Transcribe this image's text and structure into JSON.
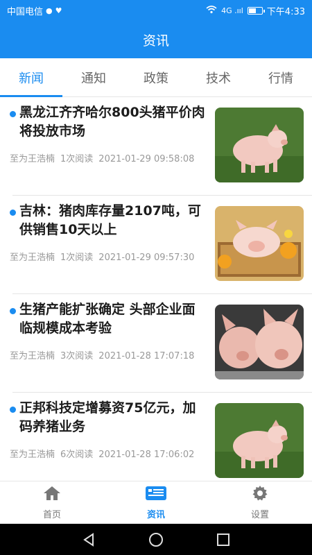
{
  "status_bar": {
    "carrier": "中国电信",
    "signal": "4G .ııl",
    "time": "下午4:33",
    "battery_level": 0.6
  },
  "header": {
    "title": "资讯"
  },
  "tabs": [
    {
      "label": "新闻",
      "active": true
    },
    {
      "label": "通知",
      "active": false
    },
    {
      "label": "政策",
      "active": false
    },
    {
      "label": "技术",
      "active": false
    },
    {
      "label": "行情",
      "active": false
    }
  ],
  "news": [
    {
      "title": "黑龙江齐齐哈尔800头猪平价肉将投放市场",
      "author": "至为王浩楠",
      "reads": "1次阅读",
      "date": "2021-01-29 09:58:08",
      "thumb": "pig-on-grass"
    },
    {
      "title": "吉林：猪肉库存量2107吨，可供销售10天以上",
      "author": "至为王浩楠",
      "reads": "1次阅读",
      "date": "2021-01-29 09:57:30",
      "thumb": "piglet-in-basket"
    },
    {
      "title": "生猪产能扩张确定 头部企业面临规模成本考验",
      "author": "至为王浩楠",
      "reads": "3次阅读",
      "date": "2021-01-28 17:07:18",
      "thumb": "two-pigs"
    },
    {
      "title": "正邦科技定增募资75亿元，加码养猪业务",
      "author": "至为王浩楠",
      "reads": "6次阅读",
      "date": "2021-01-28 17:06:02",
      "thumb": "pig-on-grass"
    }
  ],
  "bottom_nav": [
    {
      "label": "首页",
      "icon": "home-icon",
      "active": false
    },
    {
      "label": "资讯",
      "icon": "news-icon",
      "active": true
    },
    {
      "label": "设置",
      "icon": "gear-icon",
      "active": false
    }
  ],
  "colors": {
    "accent": "#1a8cf0"
  }
}
